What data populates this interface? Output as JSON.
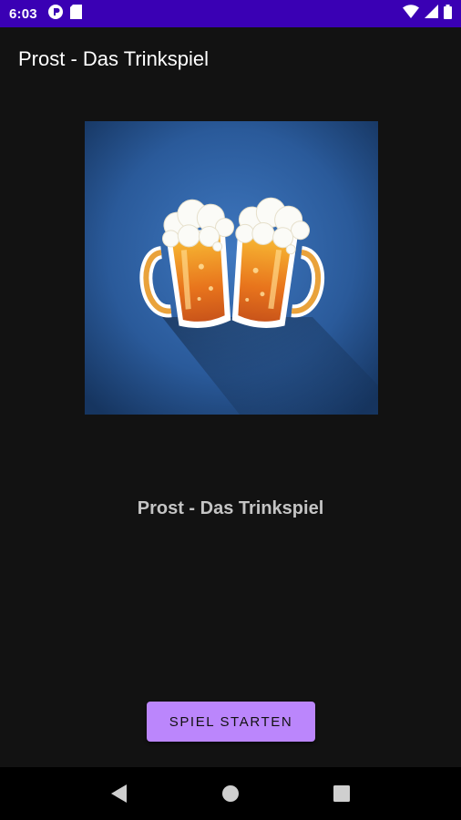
{
  "status_bar": {
    "time": "6:03",
    "left_icons": [
      "notification-app-icon",
      "sd-card-icon"
    ],
    "right_icons": [
      "wifi-icon",
      "signal-icon",
      "battery-icon"
    ]
  },
  "app_bar": {
    "title": "Prost - Das Trinkspiel"
  },
  "main": {
    "image_name": "beer-mugs-cheers-image",
    "title": "Prost - Das Trinkspiel",
    "start_button_label": "SPIEL STARTEN"
  },
  "nav_bar": {
    "items": [
      "back-icon",
      "home-icon",
      "recents-icon"
    ]
  },
  "colors": {
    "status_bar": "#3a00b4",
    "background": "#121212",
    "accent_button": "#bb86fc",
    "image_background": "#2c5fa0"
  }
}
